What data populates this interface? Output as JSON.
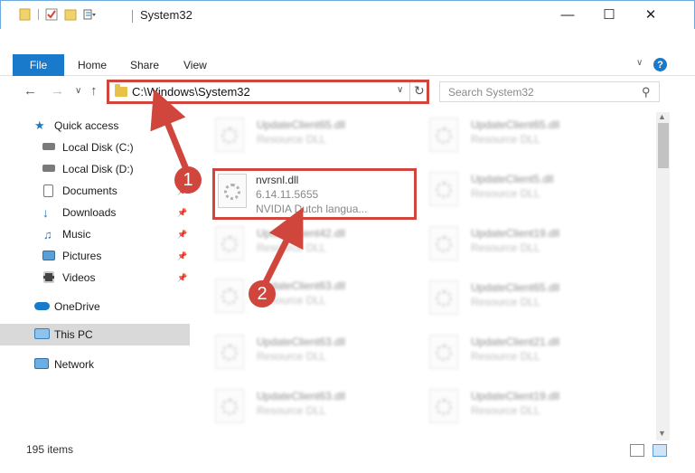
{
  "window": {
    "title": "System32",
    "minimize": "—",
    "maximize": "☐",
    "close": "✕"
  },
  "ribbon": {
    "tabs": [
      "File",
      "Home",
      "Share",
      "View"
    ]
  },
  "address": {
    "path": "C:\\Windows\\System32",
    "search_placeholder": "Search System32"
  },
  "sidebar": {
    "items": [
      {
        "label": "Quick access",
        "icon": "star-icon",
        "pinned": false
      },
      {
        "label": "Local Disk (C:)",
        "icon": "drive-icon",
        "pinned": false
      },
      {
        "label": "Local Disk (D:)",
        "icon": "drive-icon",
        "pinned": false
      },
      {
        "label": "Documents",
        "icon": "documents-icon",
        "pinned": true
      },
      {
        "label": "Downloads",
        "icon": "download-icon",
        "pinned": true
      },
      {
        "label": "Music",
        "icon": "music-icon",
        "pinned": true
      },
      {
        "label": "Pictures",
        "icon": "pictures-icon",
        "pinned": true
      },
      {
        "label": "Videos",
        "icon": "videos-icon",
        "pinned": true
      },
      {
        "label": "OneDrive",
        "icon": "cloud-icon",
        "pinned": false
      },
      {
        "label": "This PC",
        "icon": "computer-icon",
        "pinned": false,
        "selected": true
      },
      {
        "label": "Network",
        "icon": "network-icon",
        "pinned": false
      }
    ]
  },
  "files": {
    "highlighted": {
      "name": "nvrsnl.dll",
      "version": "6.14.11.5655",
      "description": "NVIDIA Dutch langua..."
    },
    "left_column": [
      {
        "name": "UpdateClient65.dll",
        "type": "Resource DLL"
      },
      {
        "name": "UpdateClient42.dll",
        "type": "Resource DLL"
      },
      {
        "name": "UpdateClient63.dll",
        "type": "Resource DLL"
      },
      {
        "name": "UpdateClient63.dll",
        "type": "Resource DLL"
      },
      {
        "name": "UpdateClient63.dll",
        "type": "Resource DLL"
      }
    ],
    "right_column": [
      {
        "name": "UpdateClient65.dll",
        "type": "Resource DLL"
      },
      {
        "name": "UpdateClient5.dll",
        "type": "Resource DLL"
      },
      {
        "name": "UpdateClient19.dll",
        "type": "Resource DLL"
      },
      {
        "name": "UpdateClient65.dll",
        "type": "Resource DLL"
      },
      {
        "name": "UpdateClient21.dll",
        "type": "Resource DLL"
      },
      {
        "name": "UpdateClient19.dll",
        "type": "Resource DLL"
      }
    ]
  },
  "status": {
    "item_count": "195 items"
  },
  "markers": [
    "1",
    "2"
  ],
  "colors": {
    "accent": "#1979ca",
    "highlight": "#d0453c",
    "folder": "#e8c04a"
  }
}
